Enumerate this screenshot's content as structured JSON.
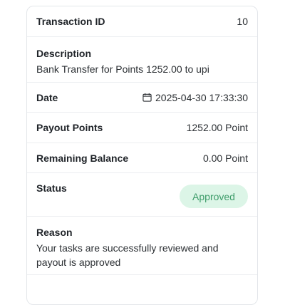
{
  "transaction": {
    "id_label": "Transaction ID",
    "id_value": "10",
    "description_label": "Description",
    "description_value": "Bank Transfer for Points 1252.00 to upi",
    "date_label": "Date",
    "date_value": "2025-04-30 17:33:30",
    "date_icon": "calendar-icon",
    "payout_label": "Payout Points",
    "payout_value": "1252.00 Point",
    "balance_label": "Remaining Balance",
    "balance_value": "0.00 Point",
    "status_label": "Status",
    "status_value": "Approved",
    "status_color": "#3e9c6a",
    "status_bg": "#dcf5e7",
    "reason_label": "Reason",
    "reason_value": "Your tasks are successfully reviewed and payout is approved"
  }
}
